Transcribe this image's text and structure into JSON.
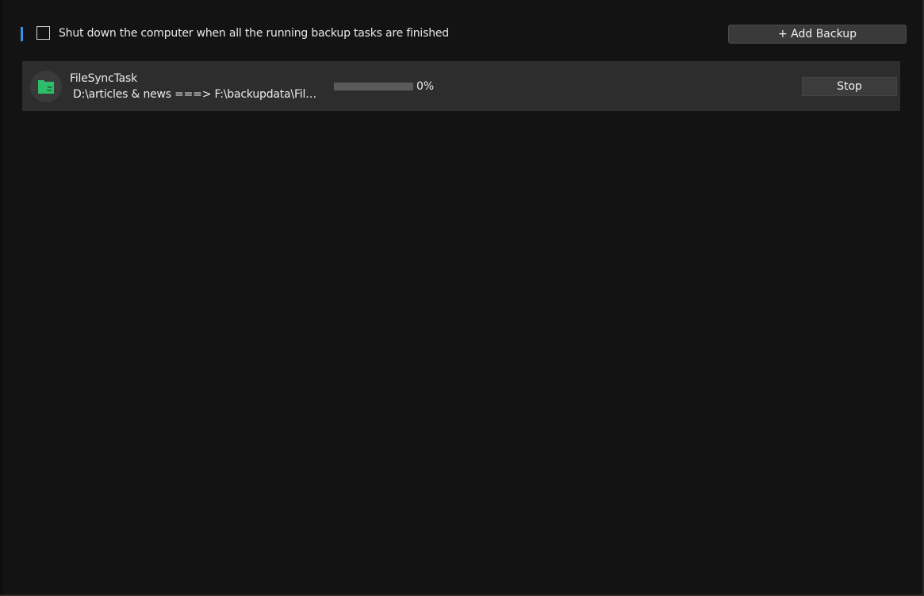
{
  "toolbar": {
    "shutdown_checkbox_label": "Shut down the computer when all the running backup tasks are finished",
    "shutdown_checked": false,
    "add_backup_label": "+ Add Backup"
  },
  "tasks": [
    {
      "name": "FileSyncTask",
      "path": "D:\\articles & news ===> F:\\backupdata\\File...",
      "icon": "folder-sync-icon",
      "progress_percent": 0,
      "progress_label": "0%",
      "stop_label": "Stop"
    }
  ],
  "colors": {
    "background": "#131313",
    "accent": "#3a8ee6",
    "task_icon": "#2ebd6b",
    "row_background": "#2d2d2d"
  }
}
